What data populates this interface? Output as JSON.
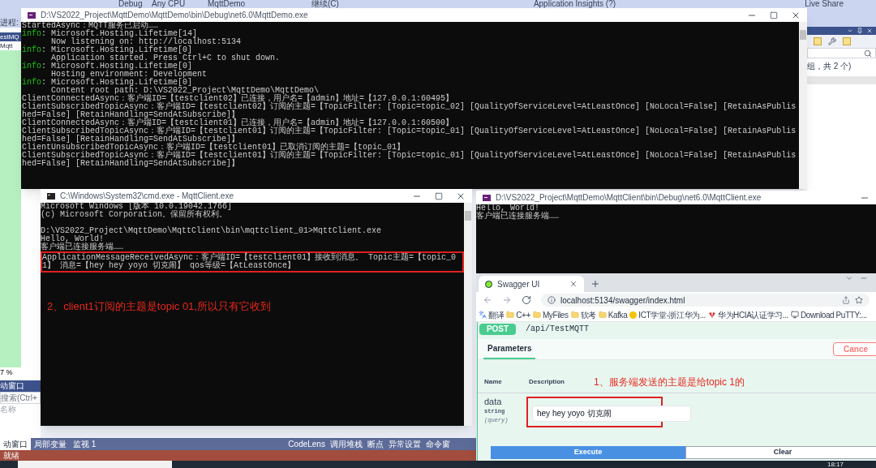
{
  "ide": {
    "toolbar": [
      {
        "text": "Debug"
      },
      {
        "text": "Any CPU"
      },
      {
        "text": "MqttDemo"
      },
      {
        "text": "继续(C)"
      },
      {
        "text": "Application Insights (?)"
      },
      {
        "text": "Live Share"
      }
    ],
    "side_labels": [
      "进程:",
      "estMQ",
      "Mqtt"
    ],
    "zoom": "7 %",
    "tool_window": {
      "title": "动窗口",
      "search": "搜索(Ctrl+",
      "column": "名称"
    },
    "explorer_summary": "组，共 2 个)",
    "left_tabs": [
      {
        "label": "动窗口",
        "selected": true
      },
      {
        "label": "局部变量",
        "selected": false
      },
      {
        "label": "监视 1",
        "selected": false
      }
    ],
    "right_tabs": [
      {
        "label": "CodeLens",
        "selected": false
      },
      {
        "label": "调用堆栈",
        "selected": false
      },
      {
        "label": "断点",
        "selected": false
      },
      {
        "label": "异常设置",
        "selected": false
      },
      {
        "label": "命令窗",
        "selected": false
      }
    ],
    "status": "就绪"
  },
  "taskbar": {
    "time": "18:17"
  },
  "server_console": {
    "title": "D:\\VS2022_Project\\MqttDemo\\MqttDemo\\bin\\Debug\\net6.0\\MqttDemo.exe",
    "lines": [
      {
        "kind": "plain",
        "text": "StartedAsync：MQTT服务已启动……"
      },
      {
        "kind": "info",
        "label": "info",
        "text": ": Microsoft.Hosting.Lifetime[14]"
      },
      {
        "kind": "plain",
        "text": "      Now listening on: http://localhost:5134"
      },
      {
        "kind": "info",
        "label": "info",
        "text": ": Microsoft.Hosting.Lifetime[0]"
      },
      {
        "kind": "plain",
        "text": "      Application started. Press Ctrl+C to shut down."
      },
      {
        "kind": "info",
        "label": "info",
        "text": ": Microsoft.Hosting.Lifetime[0]"
      },
      {
        "kind": "plain",
        "text": "      Hosting environment: Development"
      },
      {
        "kind": "info",
        "label": "info",
        "text": ": Microsoft.Hosting.Lifetime[0]"
      },
      {
        "kind": "plain",
        "text": "      Content root path: D:\\VS2022_Project\\MqttDemo\\MqttDemo\\"
      },
      {
        "kind": "plain",
        "text": "ClientConnectedAsync：客户端ID=【testclient02】已连接，用户名=【admin】地址=【127.0.0.1:60495】"
      },
      {
        "kind": "plain",
        "text": "ClientSubscribedTopicAsync：客户端ID=【testclient02】订阅的主题=【TopicFilter: [Topic=topic_02] [QualityOfServiceLevel=AtLeastOnce] [NoLocal=False] [RetainAsPublished=False] [RetainHandling=SendAtSubscribe]】"
      },
      {
        "kind": "plain",
        "text": "ClientConnectedAsync：客户端ID=【testclient01】已连接，用户名=【admin】地址=【127.0.0.1:60500】"
      },
      {
        "kind": "plain",
        "text": "ClientSubscribedTopicAsync：客户端ID=【testclient01】订阅的主题=【TopicFilter: [Topic=topic_01] [QualityOfServiceLevel=AtLeastOnce] [NoLocal=False] [RetainAsPublished=False] [RetainHandling=SendAtSubscribe]】"
      },
      {
        "kind": "plain",
        "text": "ClientUnsubscribedTopicAsync：客户端ID=【testclient01】已取消订阅的主题=【topic_01】"
      },
      {
        "kind": "plain",
        "text": "ClientSubscribedTopicAsync：客户端ID=【testclient01】订阅的主题=【TopicFilter: [Topic=topic_01] [QualityOfServiceLevel=AtLeastOnce] [NoLocal=False] [RetainAsPublished=False] [RetainHandling=SendAtSubscribe]】"
      }
    ]
  },
  "client_cmd": {
    "title": "C:\\Windows\\System32\\cmd.exe - MqttClient.exe",
    "lines": [
      {
        "text": "Microsoft Windows [版本 10.0.19042.1766]",
        "space_before": false,
        "highlighted": false
      },
      {
        "text": "(c) Microsoft Corporation。保留所有权利。",
        "space_before": false,
        "highlighted": false
      },
      {
        "text": "D:\\VS2022_Project\\MqttDemo\\MqttClient\\bin\\mqttclient_01>MqttClient.exe",
        "space_before": true,
        "highlighted": false
      },
      {
        "text": "Hello, World!",
        "space_before": false,
        "highlighted": false
      },
      {
        "text": "客户端已连接服务端……",
        "space_before": false,
        "highlighted": false
      },
      {
        "text": "ApplicationMessageReceivedAsync：客户端ID=【testclient01】接收到消息。 Topic主题=【topic_01】 消息=【hey hey yoyo 切克闹】 qos等级=【AtLeastOnce】",
        "space_before": false,
        "highlighted": true
      }
    ],
    "note": "2、client1订阅的主题是topic 01,所以只有它收到"
  },
  "client_console": {
    "title": "D:\\VS2022_Project\\MqttDemo\\MqttClient\\bin\\Debug\\net6.0\\MqttClient.exe",
    "lines": [
      "Hello, World!",
      "客户端已连接服务端……"
    ]
  },
  "browser": {
    "tabs": [
      {
        "title": "Swagger UI",
        "selected": true
      }
    ],
    "url": "localhost:5134/swagger/index.html",
    "bookmarks": [
      {
        "label": "翻译",
        "kind": "translate"
      },
      {
        "label": "C++",
        "kind": "folder"
      },
      {
        "label": "MyFiles",
        "kind": "folder"
      },
      {
        "label": "软考",
        "kind": "folder"
      },
      {
        "label": "Kafka",
        "kind": "folder"
      },
      {
        "label": "ICT学堂-浙江华为...",
        "kind": "badge"
      },
      {
        "label": "华为HCIA认证学习...",
        "kind": "logo"
      },
      {
        "label": "Download PuTTY:...",
        "kind": "app"
      }
    ],
    "swagger": {
      "method": "POST",
      "path": "/api/TestMQTT",
      "sections": [
        {
          "label": "Parameters",
          "selected": true
        }
      ],
      "cancel": "Cance",
      "columns": [
        "Name",
        "Description"
      ],
      "note": "1、服务端发送的主题是给topic 1的",
      "param": {
        "name": "data",
        "type": "string",
        "location": "(query)",
        "value": "hey hey yoyo 切克闹",
        "highlighted": true
      },
      "buttons": [
        {
          "label": "Execute",
          "kind": "primary"
        },
        {
          "label": "Clear",
          "kind": "secondary"
        }
      ]
    }
  }
}
